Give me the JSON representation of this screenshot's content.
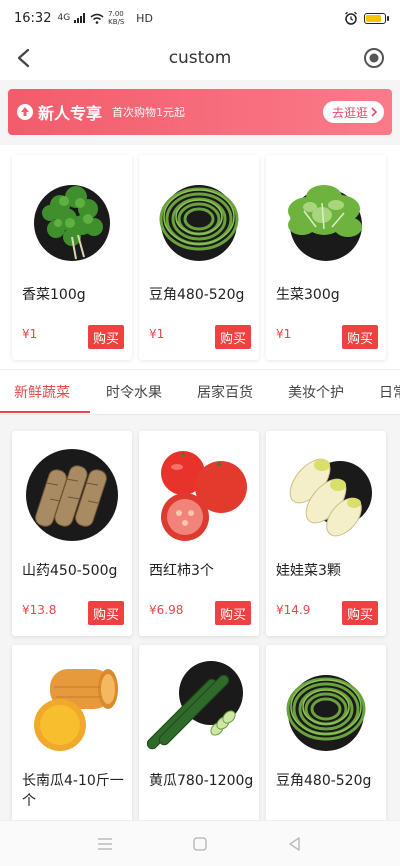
{
  "status": {
    "time": "16:32",
    "signal": "4G",
    "speed": "7.00 KB/S",
    "hd": "HD"
  },
  "nav": {
    "title": "custom"
  },
  "banner": {
    "title": "新人专享",
    "subtitle": "首次购物1元起",
    "button": "去逛逛"
  },
  "featured": [
    {
      "name": "香菜100g",
      "price": "¥1",
      "buy": "购买",
      "image": "cilantro"
    },
    {
      "name": "豆角480-520g",
      "price": "¥1",
      "buy": "购买",
      "image": "green-beans"
    },
    {
      "name": "生菜300g",
      "price": "¥1",
      "buy": "购买",
      "image": "lettuce"
    }
  ],
  "tabs": [
    {
      "label": "新鲜蔬菜",
      "active": true
    },
    {
      "label": "时令水果",
      "active": false
    },
    {
      "label": "居家百货",
      "active": false
    },
    {
      "label": "美妆个护",
      "active": false
    },
    {
      "label": "日常",
      "active": false
    }
  ],
  "products": [
    {
      "name": "山药450-500g",
      "price": "¥13.8",
      "buy": "购买",
      "image": "yam"
    },
    {
      "name": "西红柿3个",
      "price": "¥6.98",
      "buy": "购买",
      "image": "tomato"
    },
    {
      "name": "娃娃菜3颗",
      "price": "¥14.9",
      "buy": "购买",
      "image": "baby-cabbage"
    },
    {
      "name": "长南瓜4-10斤一个",
      "price": "",
      "buy": "",
      "image": "pumpkin"
    },
    {
      "name": "黄瓜780-1200g",
      "price": "",
      "buy": "",
      "image": "cucumber"
    },
    {
      "name": "豆角480-520g",
      "price": "",
      "buy": "",
      "image": "green-beans"
    }
  ],
  "colors": {
    "accent": "#e8474b",
    "banner_start": "#f25c6b",
    "banner_end": "#fb7a8a"
  }
}
